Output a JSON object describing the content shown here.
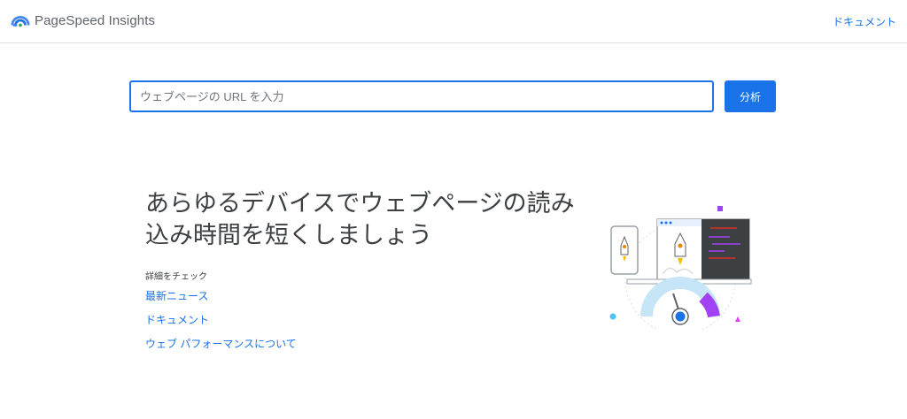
{
  "header": {
    "app_name": "PageSpeed Insights",
    "docs_link": "ドキュメント"
  },
  "search": {
    "placeholder": "ウェブページの URL を入力",
    "value": "",
    "analyze_label": "分析"
  },
  "hero": {
    "headline_line1": "あらゆるデバイスでウェブページの読み",
    "headline_line2": "込み時間を短くしましょう",
    "learn_more_label": "詳細をチェック",
    "links": [
      "最新ニュース",
      "ドキュメント",
      "ウェブ パフォーマンスについて"
    ]
  },
  "colors": {
    "accent": "#1a73e8",
    "text": "#3c4043",
    "muted": "#5f6368"
  },
  "icons": {
    "logo": "pagespeed-logo-icon",
    "illustration": "rocket-speedometer-illustration"
  }
}
